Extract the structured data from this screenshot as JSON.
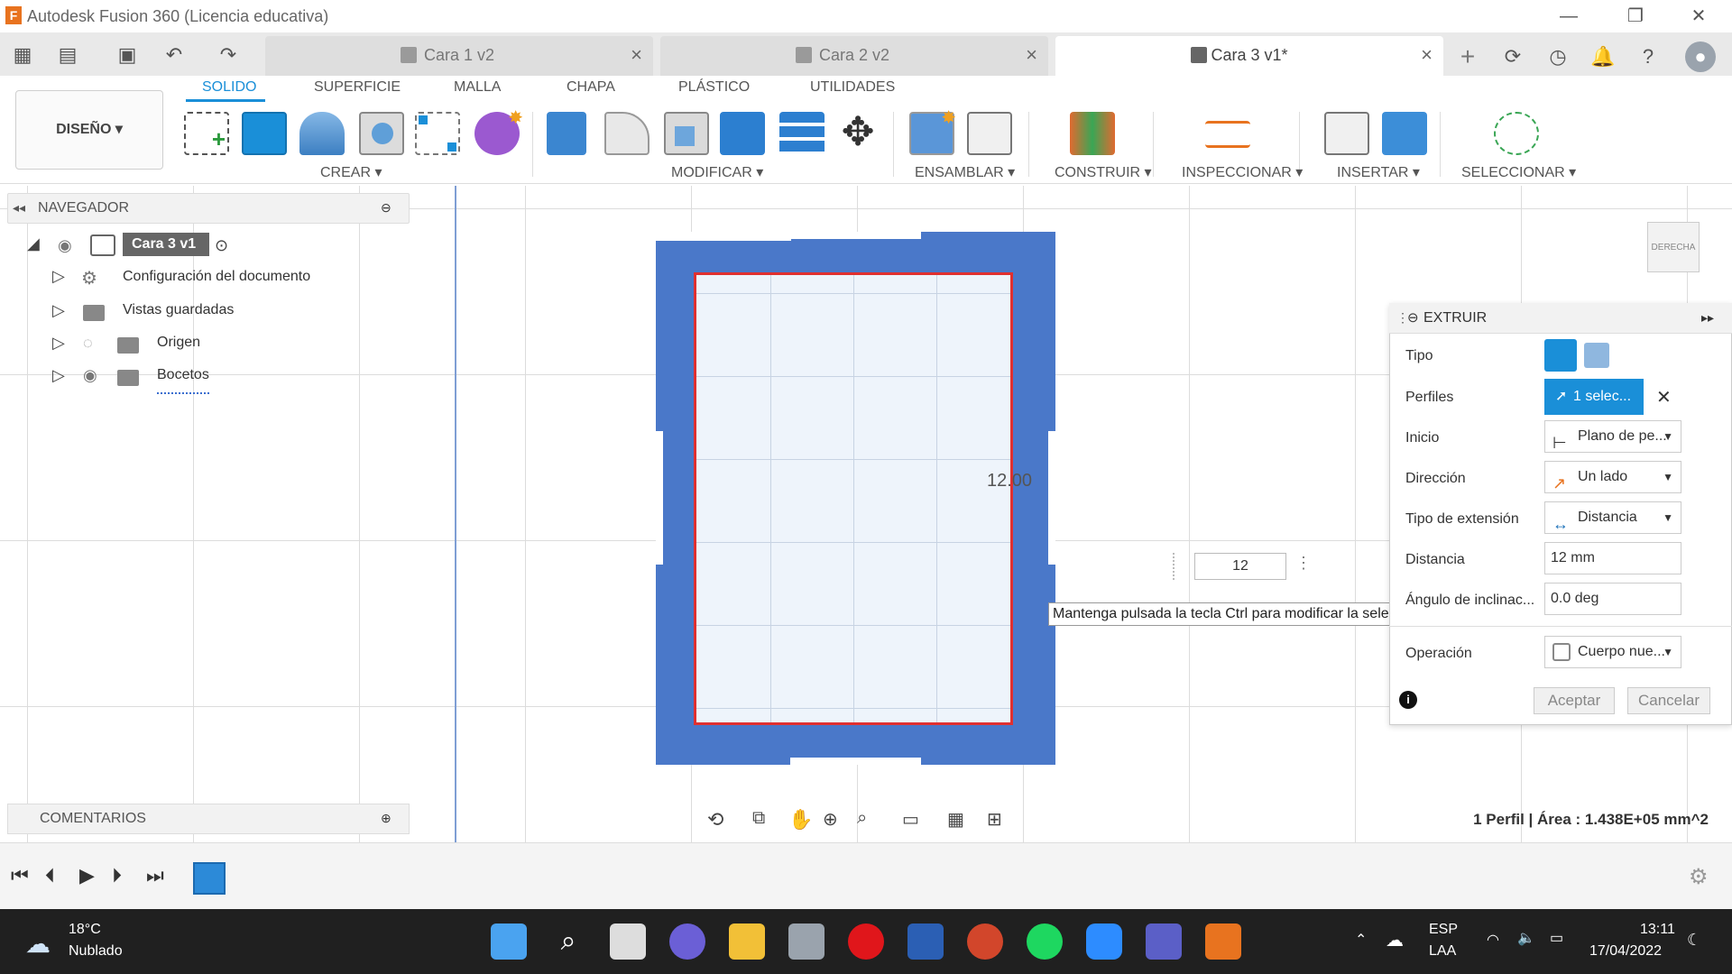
{
  "window": {
    "title": "Autodesk Fusion 360 (Licencia educativa)",
    "logo_letter": "F",
    "minimize": "—",
    "restore": "❐",
    "close": "✕"
  },
  "tabs": [
    {
      "label": "Cara 1 v2",
      "close": "×"
    },
    {
      "label": "Cara 2 v2",
      "close": "×"
    },
    {
      "label": "Cara 3 v1*",
      "close": "×"
    }
  ],
  "tab_actions": {
    "new_tab": "+"
  },
  "ribbon": {
    "workspace": "DISEÑO ▾",
    "tabs": [
      "SOLIDO",
      "SUPERFICIE",
      "MALLA",
      "CHAPA",
      "PLÁSTICO",
      "UTILIDADES"
    ],
    "groups": [
      "CREAR ▾",
      "MODIFICAR ▾",
      "ENSAMBLAR ▾",
      "CONSTRUIR ▾",
      "INSPECCIONAR ▾",
      "INSERTAR ▾",
      "SELECCIONAR ▾"
    ]
  },
  "navigator": {
    "title": "NAVEGADOR",
    "root": "Cara 3 v1",
    "items": [
      "Configuración del documento",
      "Vistas guardadas",
      "Origen",
      "Bocetos"
    ]
  },
  "comments": {
    "title": "COMENTARIOS"
  },
  "sketch": {
    "dimension": "12.00"
  },
  "view_cube": {
    "label": "DERECHA"
  },
  "dim_input": {
    "value": "12"
  },
  "tooltip": "Mantenga pulsada la tecla Ctrl para modificar la selección",
  "extrude": {
    "title": "EXTRUIR",
    "rows": {
      "tipo": "Tipo",
      "perfiles": "Perfiles",
      "inicio": "Inicio",
      "direccion": "Dirección",
      "tipo_ext": "Tipo de extensión",
      "distancia": "Distancia",
      "angulo": "Ángulo de inclinac...",
      "operacion": "Operación"
    },
    "values": {
      "perfiles": "1 selec...",
      "inicio": "Plano de pe...",
      "direccion": "Un lado",
      "tipo_ext": "Distancia",
      "distancia": "12 mm",
      "angulo": "0.0 deg",
      "operacion": "Cuerpo nue..."
    },
    "ok": "Aceptar",
    "cancel": "Cancelar"
  },
  "status": "1 Perfil | Área : 1.438E+05 mm^2",
  "taskbar": {
    "weather_temp": "18°C",
    "weather_desc": "Nublado",
    "lang1": "ESP",
    "lang2": "LAA",
    "time": "13:11",
    "date": "17/04/2022"
  },
  "colors": {
    "accent": "#1a8fd8",
    "body": "#4a78c9",
    "profile_edge": "#e03030"
  }
}
